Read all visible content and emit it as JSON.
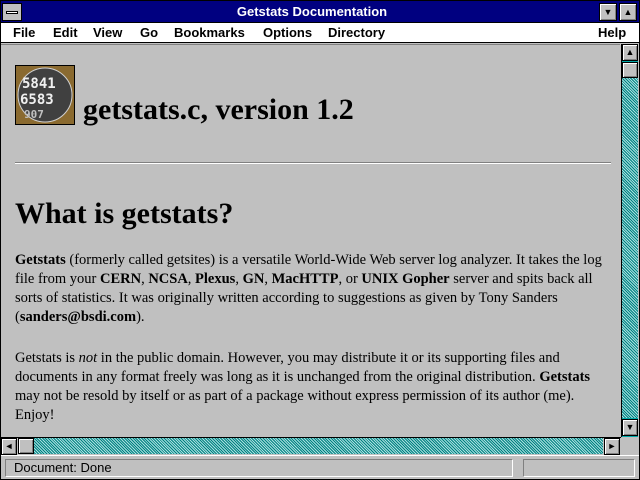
{
  "window": {
    "title": "Getstats Documentation"
  },
  "menubar": {
    "items": [
      {
        "label": "File"
      },
      {
        "label": "Edit"
      },
      {
        "label": "View"
      },
      {
        "label": "Go"
      },
      {
        "label": "Bookmarks"
      },
      {
        "label": "Options"
      },
      {
        "label": "Directory"
      },
      {
        "label": "Help"
      }
    ]
  },
  "page": {
    "title": "getstats.c, version 1.2",
    "heading": "What is getstats?",
    "p1": {
      "t1": "Getstats",
      "t2": " (formerly called getsites) is a versatile World-Wide Web server log analyzer. It takes the log file from your ",
      "t3": "CERN",
      "t4": ", ",
      "t5": "NCSA",
      "t6": ", ",
      "t7": "Plexus",
      "t8": ", ",
      "t9": "GN",
      "t10": ", ",
      "t11": "MacHTTP",
      "t12": ", or ",
      "t13": "UNIX Gopher",
      "t14": " server and spits back all sorts of statistics. It was originally written according to suggestions as given by Tony Sanders (",
      "t15": "sanders@bsdi.com",
      "t16": ")."
    },
    "p2": {
      "t1": "Getstats is ",
      "t2": "not",
      "t3": " in the public domain. However, you may distribute it or its supporting files and documents in any format freely was long as it is unchanged from the original distribution. ",
      "t4": "Getstats",
      "t5": " may not be resold by itself or as part of a package without express permission of its author (me). Enjoy!"
    },
    "logo_text": "5841 6583"
  },
  "status": {
    "text": "Document: Done"
  },
  "icons": {
    "system_menu": "system-menu-icon",
    "minimize": "minimize-icon",
    "maximize": "maximize-icon",
    "scroll_up": "arrow-up-icon",
    "scroll_down": "arrow-down-icon",
    "scroll_left": "arrow-left-icon",
    "scroll_right": "arrow-right-icon"
  },
  "colors": {
    "titlebar": "#000080",
    "scrollbar": "#00a8a8",
    "background": "#c0c0c0"
  }
}
